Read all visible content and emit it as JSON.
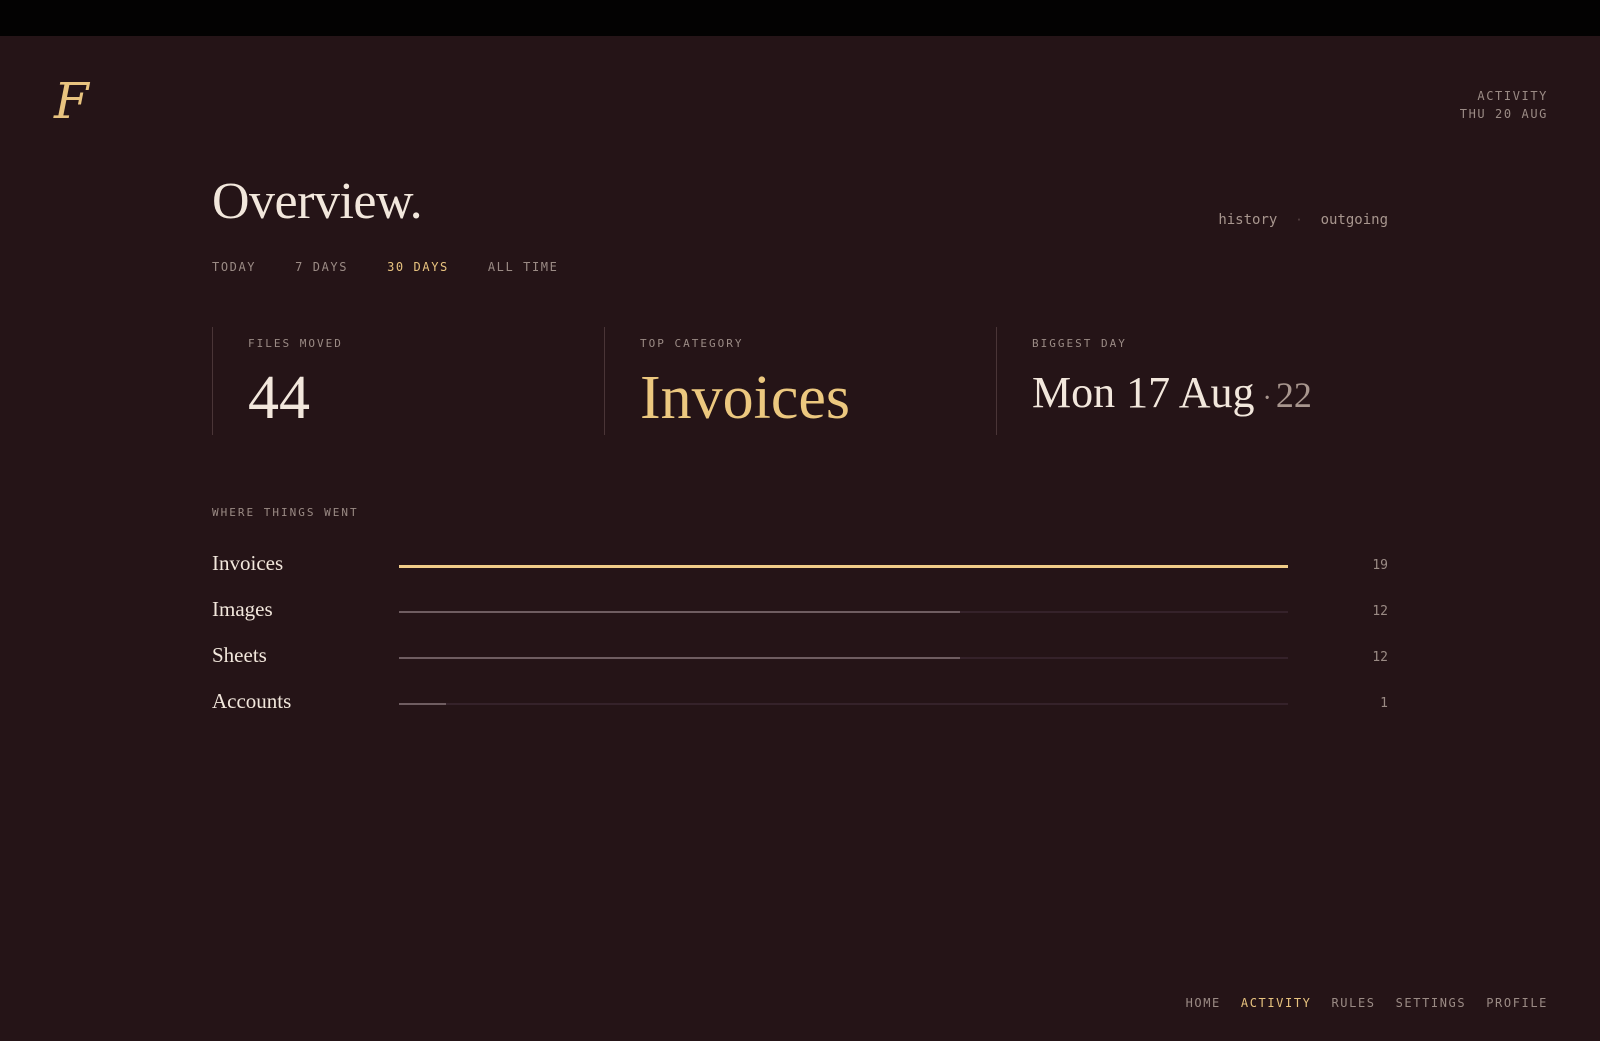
{
  "app": {
    "logo_letter": "F",
    "section": "ACTIVITY",
    "date": "THU 20 AUG"
  },
  "page": {
    "title": "Overview.",
    "view_links": [
      "history",
      "outgoing"
    ],
    "view_separator": "·"
  },
  "range_tabs": [
    {
      "label": "TODAY",
      "active": false
    },
    {
      "label": "7 DAYS",
      "active": false
    },
    {
      "label": "30 DAYS",
      "active": true
    },
    {
      "label": "ALL TIME",
      "active": false
    }
  ],
  "stats": {
    "files_moved": {
      "label": "FILES MOVED",
      "value": "44"
    },
    "top_category": {
      "label": "TOP CATEGORY",
      "value": "Invoices"
    },
    "biggest_day": {
      "label": "BIGGEST DAY",
      "value": "Mon 17 Aug",
      "separator": "·",
      "count": "22"
    }
  },
  "breakdown": {
    "label": "WHERE THINGS WENT",
    "max": 19,
    "items": [
      {
        "name": "Invoices",
        "value": 19
      },
      {
        "name": "Images",
        "value": 12
      },
      {
        "name": "Sheets",
        "value": 12
      },
      {
        "name": "Accounts",
        "value": 1
      }
    ]
  },
  "bottom_nav": [
    {
      "label": "HOME",
      "active": false
    },
    {
      "label": "ACTIVITY",
      "active": true
    },
    {
      "label": "RULES",
      "active": false
    },
    {
      "label": "SETTINGS",
      "active": false
    },
    {
      "label": "PROFILE",
      "active": false
    }
  ],
  "colors": {
    "background": "#251417",
    "accent": "#e8c37f",
    "text": "#f2e7dc",
    "muted": "#9b8b85"
  }
}
